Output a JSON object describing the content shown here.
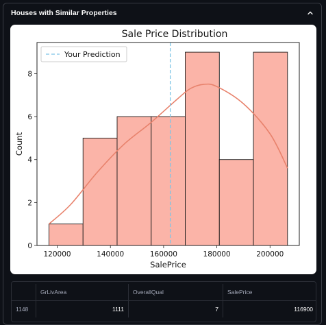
{
  "expander": {
    "title": "Houses with Similar Properties",
    "expanded": true,
    "chevron_icon": "chevron-up-icon"
  },
  "chart_data": {
    "type": "bar",
    "title": "Sale Price Distribution",
    "xlabel": "SalePrice",
    "ylabel": "Count",
    "bins": [
      {
        "start": 116900,
        "end": 129710,
        "count": 1
      },
      {
        "start": 129710,
        "end": 142520,
        "count": 5
      },
      {
        "start": 142520,
        "end": 155330,
        "count": 6
      },
      {
        "start": 155330,
        "end": 168140,
        "count": 6
      },
      {
        "start": 168140,
        "end": 180950,
        "count": 9
      },
      {
        "start": 180950,
        "end": 193760,
        "count": 4
      },
      {
        "start": 193760,
        "end": 206570,
        "count": 9
      }
    ],
    "kde": {
      "x": [
        116900,
        125000,
        135000,
        145000,
        155000,
        165000,
        170000,
        175000,
        180000,
        190000,
        200000,
        206570
      ],
      "y": [
        1.0,
        1.9,
        3.4,
        4.7,
        5.7,
        6.8,
        7.3,
        7.5,
        7.4,
        6.6,
        5.2,
        3.6
      ]
    },
    "prediction_line": {
      "x": 162500,
      "label": "Your Prediction"
    },
    "xticks": [
      120000,
      140000,
      160000,
      180000,
      200000
    ],
    "yticks": [
      0,
      2,
      4,
      6,
      8
    ],
    "xlim": [
      112400,
      211000
    ],
    "ylim": [
      0,
      9.45
    ],
    "legend_position": "upper-left",
    "colors": {
      "bar_fill": "#fbb4a8",
      "bar_edge": "#1a1a1a",
      "kde_line": "#e8826c",
      "prediction_line": "#7ec4e6"
    }
  },
  "table": {
    "columns": [
      "",
      "GrLivArea",
      "OverallQual",
      "SalePrice"
    ],
    "rows": [
      {
        "index": "1148",
        "GrLivArea": "1111",
        "OverallQual": "7",
        "SalePrice": "116900"
      }
    ]
  }
}
